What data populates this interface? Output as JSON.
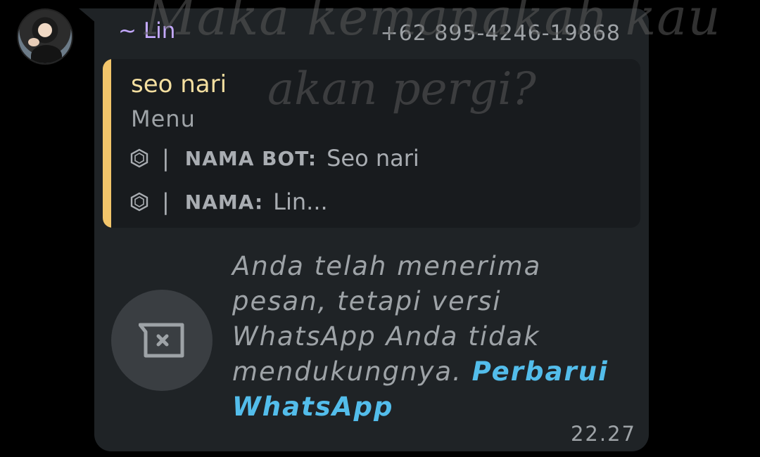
{
  "wallpaper": {
    "line1": "Maka kemanakah kau",
    "line2": "akan pergi?"
  },
  "message": {
    "sender_name": "~ Lin",
    "sender_phone": "+62 895-4246-19868",
    "quoted": {
      "author": "seo nari",
      "title": "Menu",
      "rows": [
        {
          "icon": "hexagon-icon",
          "separator": "|",
          "label": "NAMA BOT:",
          "value": "Seo nari"
        },
        {
          "icon": "hexagon-icon",
          "separator": "|",
          "label": "NAMA:",
          "value": "Lin..."
        }
      ]
    },
    "unsupported_text": "Anda telah menerima pesan, tetapi versi WhatsApp Anda tidak mendukungnya.",
    "update_link": "Perbarui WhatsApp",
    "time": "22.27",
    "icon": "unsupported-message-icon"
  },
  "colors": {
    "background": "#000000",
    "bubble": "#1f2326",
    "sender": "#c4a9ff",
    "quote_bar": "#f2c56b",
    "link": "#53bdeb"
  }
}
